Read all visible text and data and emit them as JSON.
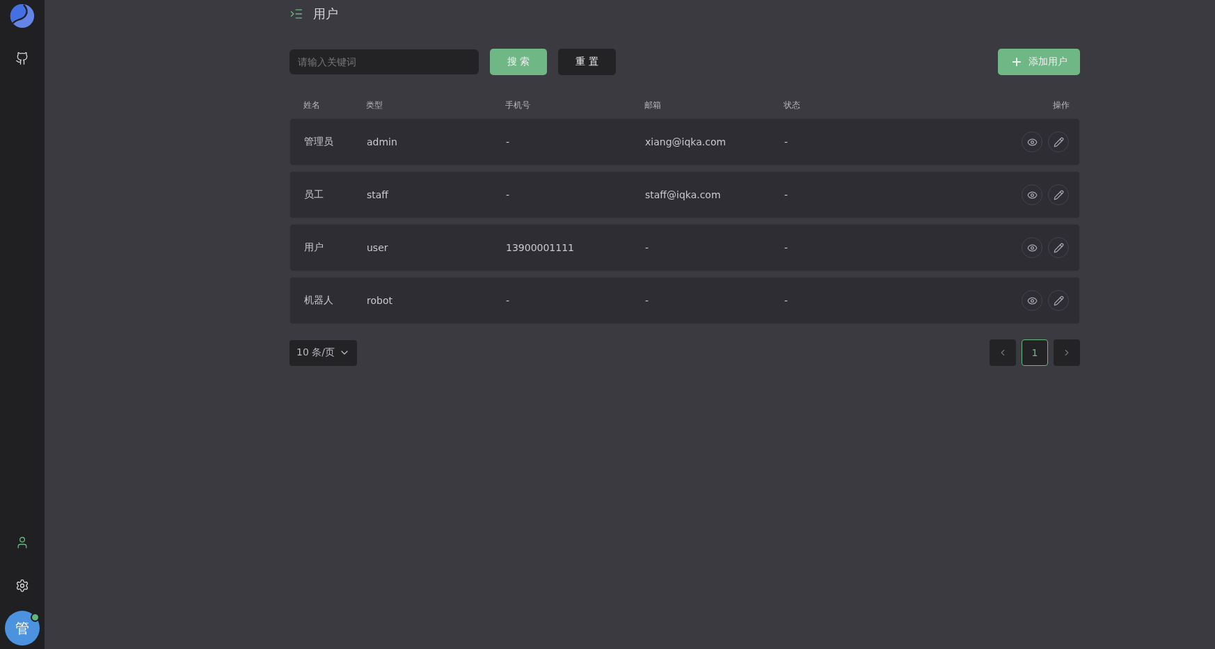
{
  "sidebar": {
    "avatar": {
      "label": "管",
      "online": true
    },
    "nav": [
      {
        "kind": "user",
        "selected": true
      },
      {
        "kind": "settings",
        "selected": false
      }
    ]
  },
  "header": {
    "title": "用户"
  },
  "toolbar": {
    "search": {
      "placeholder": "请输入关键词"
    },
    "search_button": "搜 索",
    "reset_button": "重 置",
    "add_button": "添加用户"
  },
  "table": {
    "columns": [
      "姓名",
      "类型",
      "手机号",
      "邮箱",
      "状态",
      "操作"
    ],
    "rows": [
      {
        "name": "管理员",
        "type": "admin",
        "phone": "-",
        "email": "xiang@iqka.com",
        "status": "-"
      },
      {
        "name": "员工",
        "type": "staff",
        "phone": "-",
        "email": "staff@iqka.com",
        "status": "-"
      },
      {
        "name": "用户",
        "type": "user",
        "phone": "13900001111",
        "email": "-",
        "status": "-"
      },
      {
        "name": "机器人",
        "type": "robot",
        "phone": "-",
        "email": "-",
        "status": "-"
      }
    ]
  },
  "pagination": {
    "page_size": "10 条/页",
    "pages": [
      {
        "label": "1",
        "selected": true
      }
    ]
  }
}
